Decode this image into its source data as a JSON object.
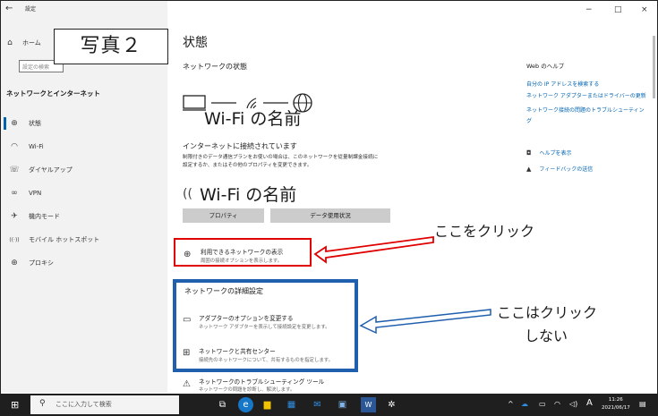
{
  "window": {
    "back": "←",
    "title": "設定",
    "minimize": "−",
    "maximize": "□",
    "close": "×"
  },
  "photo_tag": "写真２",
  "sidebar": {
    "home": "ホーム",
    "home_icon": "⌂",
    "search_placeholder": "設定の検索",
    "section_title": "ネットワークとインターネット",
    "items": [
      {
        "icon": "⊕",
        "label": "状態"
      },
      {
        "icon": "◠",
        "label": "Wi-Fi"
      },
      {
        "icon": "☏",
        "label": "ダイヤルアップ"
      },
      {
        "icon": "∞",
        "label": "VPN"
      },
      {
        "icon": "✈",
        "label": "機内モード"
      },
      {
        "icon": "((·))",
        "label": "モバイル ホットスポット"
      },
      {
        "icon": "⊕",
        "label": "プロキシ"
      }
    ]
  },
  "main": {
    "title": "状態",
    "network_status": "ネットワークの状態",
    "wifi_name_overlay": "Wi-Fi の名前",
    "connected": "インターネットに接続されています",
    "connected_detail": "制限付きのデータ通信プランをお使いの場合は、このネットワークを従量制課金接続に設定するか、またはその他のプロパティを変更できます。",
    "wifi_name": "Wi-Fi の名前",
    "wifi_icon": "((",
    "properties_button": "プロパティ",
    "data_usage_button": "データ使用状況",
    "show_networks": {
      "icon": "⊕",
      "title": "利用できるネットワークの表示",
      "sub": "周囲の接続オプションを表示します。"
    },
    "advanced_title": "ネットワークの詳細設定",
    "adapter_options": {
      "icon": "▭",
      "title": "アダプターのオプションを変更する",
      "sub": "ネットワーク アダプターを表示して接続設定を変更します。"
    },
    "sharing_center": {
      "icon": "⊞",
      "title": "ネットワークと共有センター",
      "sub": "接続先のネットワークについて、共有するものを指定します。"
    },
    "troubleshoot": {
      "icon": "⚠",
      "title": "ネットワークのトラブルシューティング ツール",
      "sub": "ネットワークの問題を診断し、解決します。"
    }
  },
  "annotations": {
    "click_here": "ここをクリック",
    "no_click_line1": "ここはクリック",
    "no_click_line2": "しない",
    "red": "#e00000",
    "blue": "#1f5fae"
  },
  "help": {
    "title": "Web のヘルプ",
    "links": [
      "自分の IP アドレスを検索する",
      "ネットワーク アダプターまたはドライバーの更新",
      "ネットワーク接続の問題のトラブルシューティン",
      "グ"
    ],
    "get_help": "ヘルプを表示",
    "feedback": "フィードバックの送信"
  },
  "taskbar": {
    "search_placeholder": "ここに入力して検索",
    "ime": "A",
    "time": "11:26",
    "date": "2021/06/17"
  }
}
